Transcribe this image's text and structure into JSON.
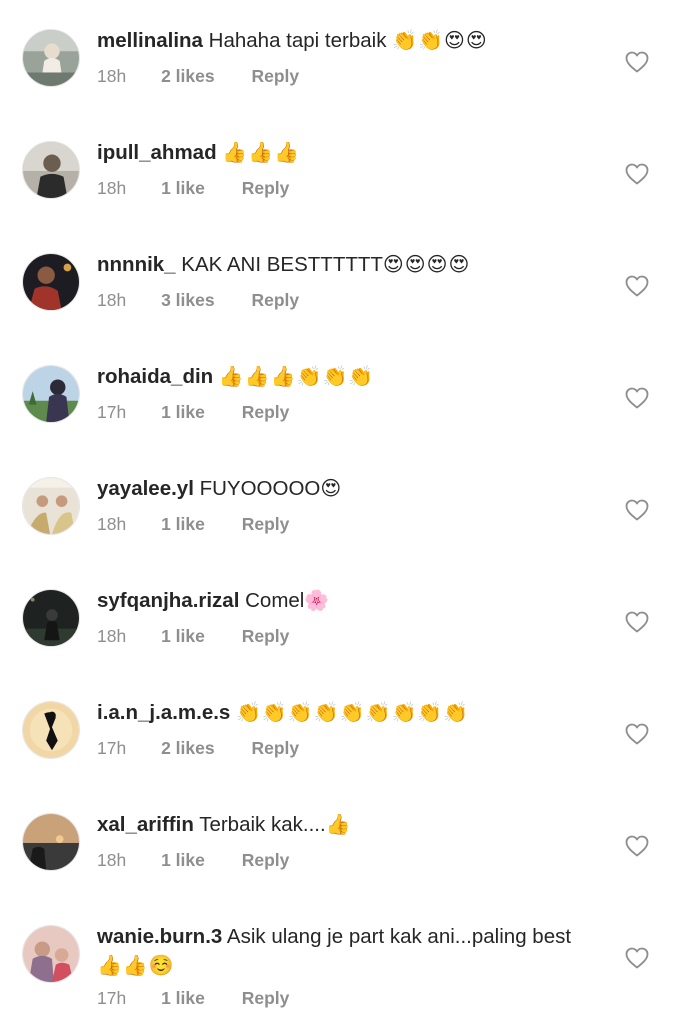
{
  "comments": [
    {
      "username": "mellinalina",
      "text": "Hahaha tapi terbaik",
      "emoji": "👏👏😍😍",
      "time": "18h",
      "likes": "2 likes",
      "reply": "Reply"
    },
    {
      "username": "ipull_ahmad",
      "text": "",
      "emoji": "👍👍👍",
      "time": "18h",
      "likes": "1 like",
      "reply": "Reply"
    },
    {
      "username": "nnnnik_",
      "text": "KAK ANI BESTTTTTT",
      "emoji": "😍😍😍😍",
      "time": "18h",
      "likes": "3 likes",
      "reply": "Reply"
    },
    {
      "username": "rohaida_din",
      "text": "",
      "emoji": "👍👍👍👏👏👏",
      "time": "17h",
      "likes": "1 like",
      "reply": "Reply"
    },
    {
      "username": "yayalee.yl",
      "text": "FUYOOOOO",
      "emoji": "😍",
      "time": "18h",
      "likes": "1 like",
      "reply": "Reply"
    },
    {
      "username": "syfqanjha.rizal",
      "text": "Comel",
      "emoji": "🌸",
      "time": "18h",
      "likes": "1 like",
      "reply": "Reply"
    },
    {
      "username": "i.a.n_j.a.m.e.s",
      "text": "",
      "emoji": "👏👏👏👏👏👏👏👏👏",
      "time": "17h",
      "likes": "2 likes",
      "reply": "Reply"
    },
    {
      "username": "xal_ariffin",
      "text": "Terbaik kak....",
      "emoji": "👍",
      "time": "18h",
      "likes": "1 like",
      "reply": "Reply"
    },
    {
      "username": "wanie.burn.3",
      "text": "Asik ulang je part kak ani...paling best",
      "emoji": "👍👍☺️",
      "time": "17h",
      "likes": "1 like",
      "reply": "Reply"
    }
  ],
  "colors": {
    "text": "#262626",
    "secondary": "#8e8e8e",
    "heart_outline": "#8e8e8e"
  },
  "icons": {
    "like": "heart-outline-icon",
    "avatar": "profile-photo"
  }
}
